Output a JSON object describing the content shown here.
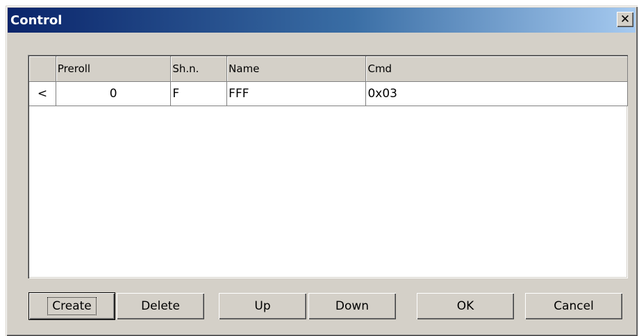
{
  "window": {
    "title": "Control",
    "close_glyph": "✕"
  },
  "grid": {
    "columns": [
      "",
      "Preroll",
      "Sh.n.",
      "Name",
      "Cmd"
    ],
    "rows": [
      {
        "indicator": "<",
        "preroll": "0",
        "shn": "F",
        "name": "FFF",
        "cmd": "0x03"
      }
    ]
  },
  "buttons": {
    "create": "Create",
    "delete": "Delete",
    "up": "Up",
    "down": "Down",
    "ok": "OK",
    "cancel": "Cancel"
  }
}
